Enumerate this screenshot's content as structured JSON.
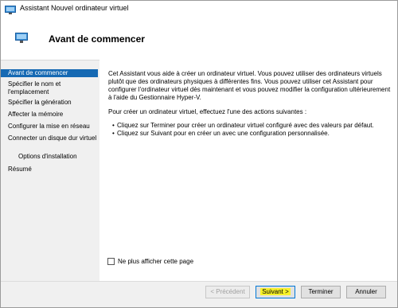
{
  "window": {
    "title": "Assistant Nouvel ordinateur virtuel"
  },
  "header": {
    "heading": "Avant de commencer"
  },
  "sidebar": {
    "items": [
      {
        "label": "Avant de commencer",
        "active": true
      },
      {
        "label": "Spécifier le nom et l'emplacement"
      },
      {
        "label": "Spécifier la génération"
      },
      {
        "label": "Affecter la mémoire"
      },
      {
        "label": "Configurer la mise en réseau"
      },
      {
        "label": "Connecter un disque dur virtuel"
      },
      {
        "label": "Options d'installation"
      },
      {
        "label": "Résumé"
      }
    ]
  },
  "content": {
    "paragraph1": "Cet Assistant vous aide à créer un ordinateur virtuel. Vous pouvez utiliser des ordinateurs virtuels plutôt que des ordinateurs physiques à différentes fins. Vous pouvez utiliser cet Assistant pour configurer l'ordinateur virtuel dès maintenant et vous pouvez modifier la configuration ultérieurement à l'aide du Gestionnaire Hyper-V.",
    "paragraph2": "Pour créer un ordinateur virtuel, effectuez l'une des actions suivantes :",
    "bullets": [
      "Cliquez sur Terminer pour créer un ordinateur virtuel configuré avec des valeurs par défaut.",
      "Cliquez sur Suivant pour en créer un avec une configuration personnalisée."
    ],
    "checkbox_label": "Ne plus afficher cette page",
    "checkbox_checked": false
  },
  "buttons": {
    "previous": "< Précédent",
    "next": "Suivant >",
    "finish": "Terminer",
    "cancel": "Annuler"
  },
  "colors": {
    "active_step": "#1669b3",
    "next_highlight": "#f7f229"
  }
}
